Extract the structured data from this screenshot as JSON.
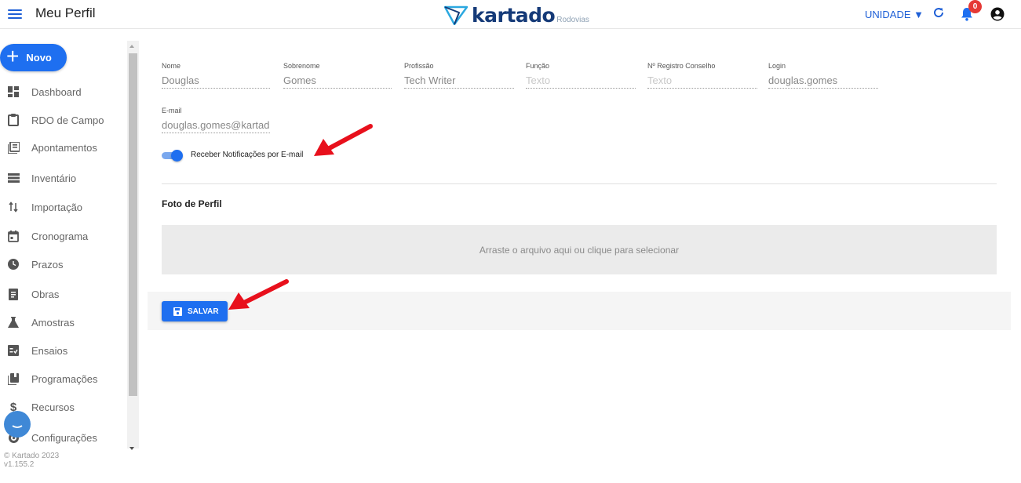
{
  "header": {
    "title": "Meu Perfil",
    "brand": "kartado",
    "brand_sub": "Rodovias",
    "unidade_label": "UNIDADE ▼",
    "notifications_count": "0"
  },
  "sidebar": {
    "new_label": "Novo",
    "items": [
      {
        "label": "Dashboard",
        "icon": "dashboard-icon"
      },
      {
        "label": "RDO de Campo",
        "icon": "clipboard-icon"
      },
      {
        "label": "Apontamentos",
        "icon": "list-icon"
      },
      {
        "label": "Inventário",
        "icon": "inventory-icon"
      },
      {
        "label": "Importação",
        "icon": "import-arrows-icon"
      },
      {
        "label": "Cronograma",
        "icon": "calendar-icon"
      },
      {
        "label": "Prazos",
        "icon": "clock-icon"
      },
      {
        "label": "Obras",
        "icon": "document-icon"
      },
      {
        "label": "Amostras",
        "icon": "flask-icon"
      },
      {
        "label": "Ensaios",
        "icon": "checklist-icon"
      },
      {
        "label": "Programações",
        "icon": "library-icon"
      },
      {
        "label": "Recursos",
        "icon": "dollar-icon"
      },
      {
        "label": "Configurações",
        "icon": "gear-icon"
      }
    ],
    "footer_copyright": "© Kartado 2023",
    "footer_version": "v1.155.2"
  },
  "profile": {
    "fields": [
      {
        "label": "Nome",
        "value": "Douglas",
        "placeholder": false
      },
      {
        "label": "Sobrenome",
        "value": "Gomes",
        "placeholder": false
      },
      {
        "label": "Profissão",
        "value": "Tech Writer",
        "placeholder": false
      },
      {
        "label": "Função",
        "value": "Texto",
        "placeholder": true
      },
      {
        "label": "Nº Registro Conselho",
        "value": "Texto",
        "placeholder": true
      },
      {
        "label": "Login",
        "value": "douglas.gomes",
        "placeholder": false
      }
    ],
    "email_label": "E-mail",
    "email_value": "douglas.gomes@kartado.",
    "notify_label": "Receber Notificações por E-mail",
    "notify_enabled": true,
    "photo_title": "Foto de Perfil",
    "dropzone_text": "Arraste o arquivo aqui ou clique para selecionar",
    "save_label": "SALVAR"
  },
  "colors": {
    "primary": "#1e6ff0",
    "brand_text": "#153a78",
    "annotation_arrow": "#e8101c",
    "badge": "#e53935"
  }
}
